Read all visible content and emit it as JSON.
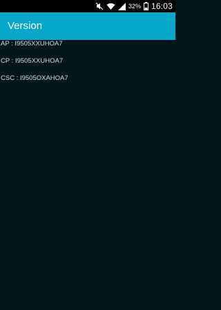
{
  "status_bar": {
    "battery_percent": "32%",
    "time": "16:03",
    "icons": [
      "mute-icon",
      "wifi-icon",
      "signal-icon",
      "battery-icon"
    ]
  },
  "app_bar": {
    "title": "Version",
    "color": "#07a7c9"
  },
  "versions": [
    {
      "text": "AP : I9505XXUHOA7"
    },
    {
      "text": "CP : I9505XXUHOA7"
    },
    {
      "text": "CSC : I9505OXAHOA7"
    }
  ],
  "colors": {
    "background": "#02161c",
    "text": "#d8dde0"
  }
}
